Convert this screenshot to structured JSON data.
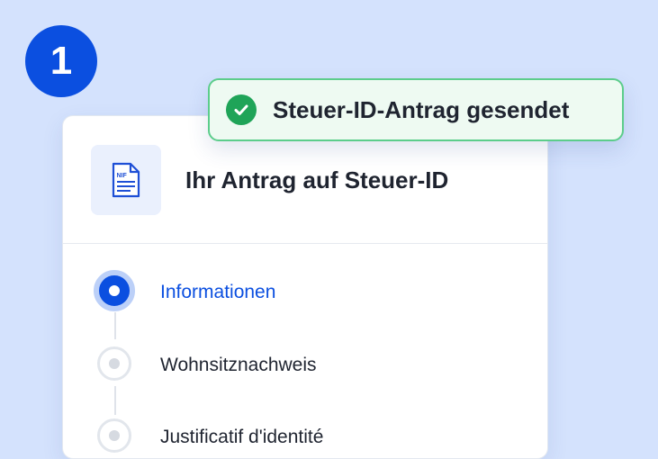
{
  "step_badge": {
    "number": "1"
  },
  "card": {
    "title": "Ihr Antrag auf Steuer-ID",
    "doc_icon_text": "NIF",
    "steps": [
      {
        "label": "Informationen",
        "state": "active"
      },
      {
        "label": "Wohnsitznachweis",
        "state": "pending"
      },
      {
        "label": "Justificatif d'identité",
        "state": "pending"
      }
    ]
  },
  "toast": {
    "message": "Steuer-ID-Antrag gesendet",
    "icon": "check-circle-icon"
  },
  "colors": {
    "background": "#d4e2fd",
    "accent": "#0b4fe0",
    "success": "#1fa458",
    "success_border": "#5ccd8b"
  }
}
